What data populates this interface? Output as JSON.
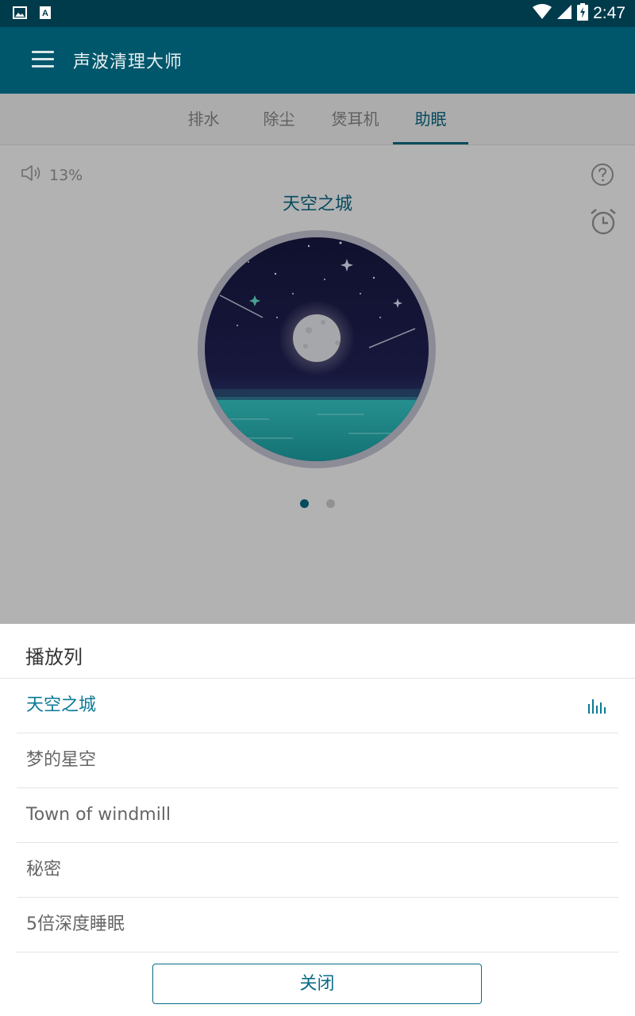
{
  "status_bar": {
    "time": "2:47",
    "left_icons": [
      "image-icon",
      "text-icon"
    ],
    "right_icons": [
      "wifi-icon",
      "signal-icon",
      "battery-charging-icon"
    ]
  },
  "app_bar": {
    "title": "声波清理大师",
    "menu_icon": "hamburger-menu-icon"
  },
  "tabs": [
    {
      "label": "排水",
      "active": false
    },
    {
      "label": "除尘",
      "active": false
    },
    {
      "label": "煲耳机",
      "active": false
    },
    {
      "label": "助眠",
      "active": true
    }
  ],
  "player": {
    "volume_icon": "speaker-icon",
    "volume": "13%",
    "help_icon": "question-icon",
    "alarm_icon": "alarm-clock-icon",
    "title": "天空之城",
    "page_indicator": {
      "count": 2,
      "active_index": 0
    }
  },
  "playlist_sheet": {
    "title": "播放列",
    "items": [
      {
        "label": "天空之城",
        "playing": true
      },
      {
        "label": "梦的星空",
        "playing": false
      },
      {
        "label": "Town of windmill",
        "playing": false
      },
      {
        "label": "秘密",
        "playing": false
      },
      {
        "label": "5倍深度睡眠",
        "playing": false
      }
    ],
    "playing_icon": "equalizer-icon",
    "close_label": "关闭"
  },
  "colors": {
    "status_bar": "#003b4c",
    "app_bar": "#00566b",
    "accent": "#0a6b86"
  }
}
